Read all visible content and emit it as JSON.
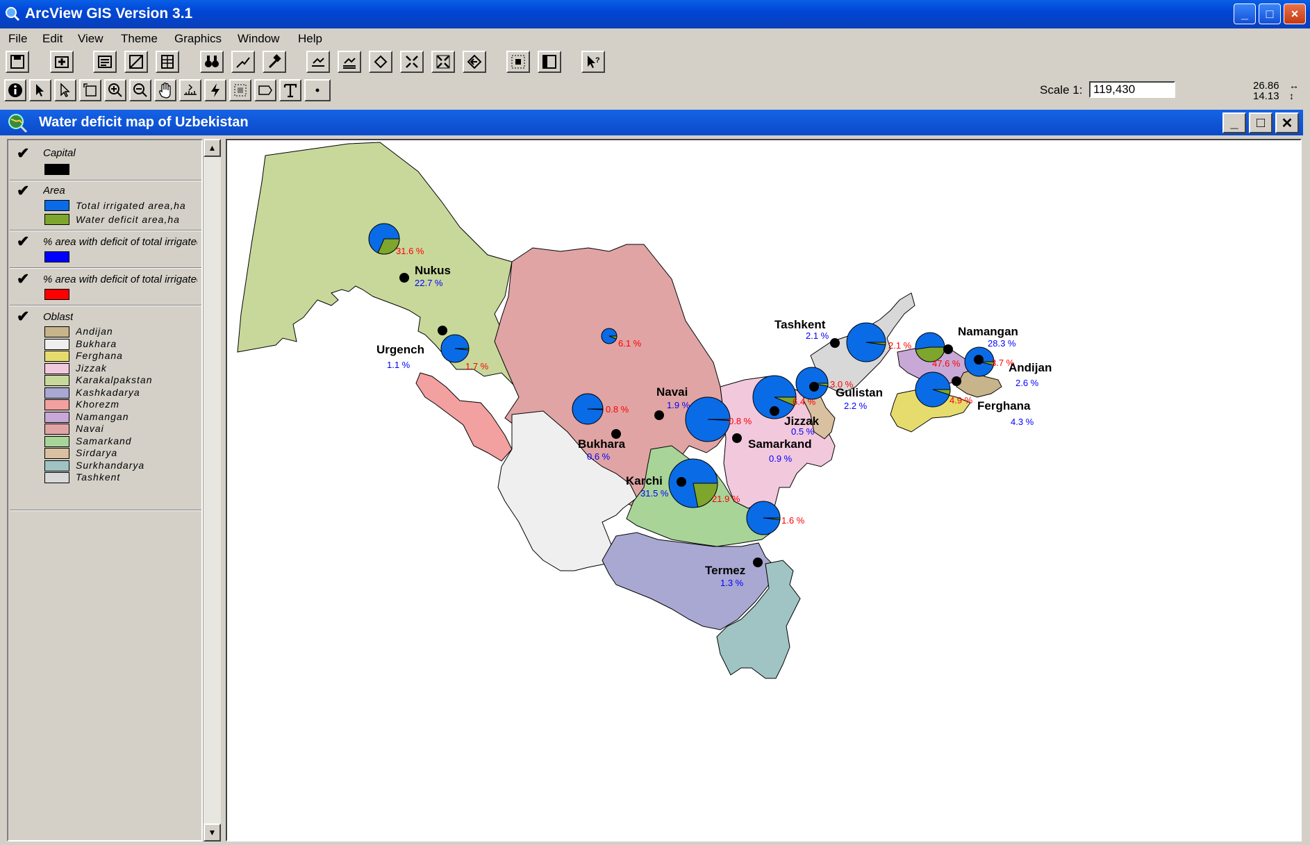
{
  "app": {
    "title": "ArcView GIS Version 3.1"
  },
  "menu": [
    "File",
    "Edit",
    "View",
    "Theme",
    "Graphics",
    "Window",
    "Help"
  ],
  "toolbar": {
    "scale_label": "Scale 1:",
    "scale_value": "119,430",
    "coord_x": "26.86",
    "coord_y": "14.13"
  },
  "view": {
    "title": "Water deficit map of Uzbekistan"
  },
  "legend": {
    "capital": {
      "name": "Capital",
      "color": "#000000"
    },
    "area": {
      "name": "Area",
      "items": [
        {
          "label": "Total irrigated area,ha",
          "color": "#0a6be6"
        },
        {
          "label": "Water deficit area,ha",
          "color": "#7fa62c"
        }
      ]
    },
    "pct_blue": {
      "name": "% area with deficit of total irrigated",
      "color": "#0000ff"
    },
    "pct_red": {
      "name": "% area with deficit of total irrigated",
      "color": "#ff0000"
    },
    "oblast": {
      "name": "Oblast",
      "items": [
        {
          "label": "Andijan",
          "color": "#c8b48a"
        },
        {
          "label": "Bukhara",
          "color": "#efefef"
        },
        {
          "label": "Ferghana",
          "color": "#e6dc6e"
        },
        {
          "label": "Jizzak",
          "color": "#f2c8dc"
        },
        {
          "label": "Karakalpakstan",
          "color": "#c8d89a"
        },
        {
          "label": "Kashkadarya",
          "color": "#a8a8d2"
        },
        {
          "label": "Khorezm",
          "color": "#f2a0a0"
        },
        {
          "label": "Namangan",
          "color": "#c8a8d6"
        },
        {
          "label": "Navai",
          "color": "#e0a4a4"
        },
        {
          "label": "Samarkand",
          "color": "#a8d498"
        },
        {
          "label": "Sirdarya",
          "color": "#d8c0a0"
        },
        {
          "label": "Surkhandarya",
          "color": "#a0c4c4"
        },
        {
          "label": "Tashkent",
          "color": "#d8d8d8"
        }
      ]
    }
  },
  "map": {
    "cities": [
      {
        "name": "Nukus",
        "pct": "22.7 %"
      },
      {
        "name": "Urgench",
        "pct": "1.1 %"
      },
      {
        "name": "Bukhara",
        "pct": "0.6 %"
      },
      {
        "name": "Navai",
        "pct": "1.9 %"
      },
      {
        "name": "Samarkand",
        "pct": "0.9 %"
      },
      {
        "name": "Jizzak",
        "pct": "0.5 %"
      },
      {
        "name": "Karchi",
        "pct": "31.5 %"
      },
      {
        "name": "Termez",
        "pct": "1.3 %"
      },
      {
        "name": "Tashkent",
        "pct": "2.1 %"
      },
      {
        "name": "Gulistan",
        "pct": "2.2 %"
      },
      {
        "name": "Namangan",
        "pct": "28.3 %"
      },
      {
        "name": "Andijan",
        "pct": "2.6 %"
      },
      {
        "name": "Ferghana",
        "pct": "4.3 %"
      }
    ],
    "pie_pcts": [
      "31.6 %",
      "1.7 %",
      "6.1 %",
      "0.8 %",
      "0.8 %",
      "21.9 %",
      "1.6 %",
      "6.4 %",
      "3.0 %",
      "2.1 %",
      "47.6 %",
      "3.7 %",
      "4.9 %"
    ]
  }
}
